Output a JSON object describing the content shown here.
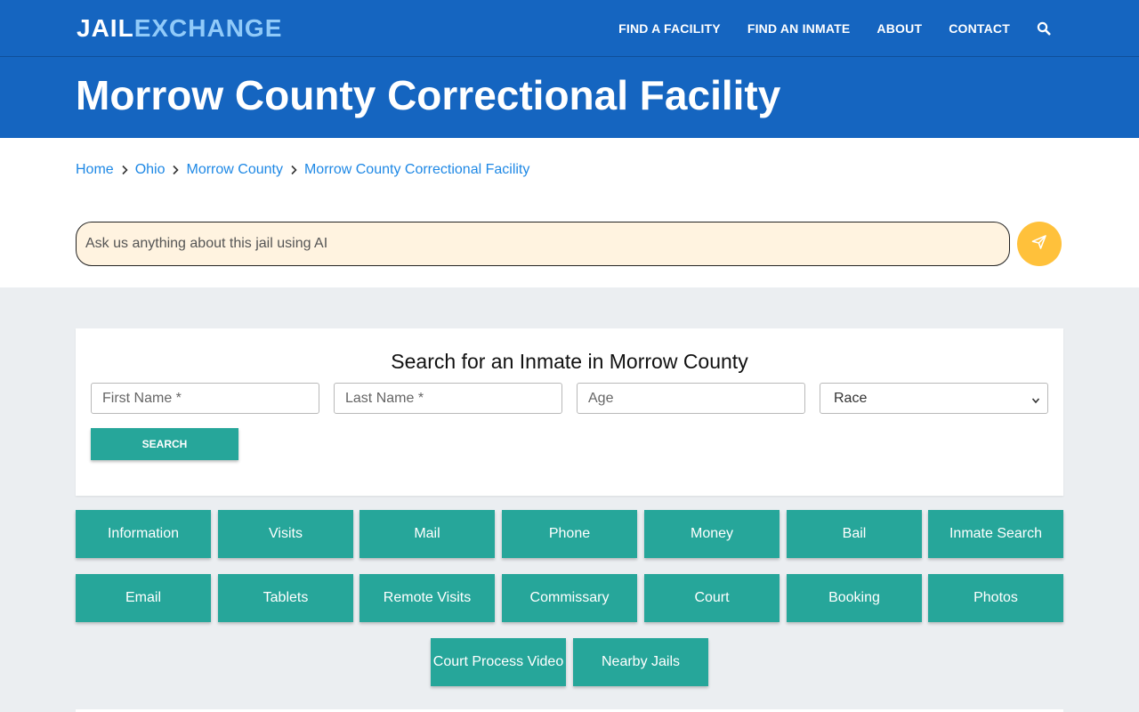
{
  "header": {
    "logo_part1": "JAIL",
    "logo_part2": "EXCHANGE",
    "nav": [
      "FIND A FACILITY",
      "FIND AN INMATE",
      "ABOUT",
      "CONTACT"
    ],
    "search_icon": "search-icon"
  },
  "hero": {
    "title": "Morrow County Correctional Facility"
  },
  "breadcrumb": [
    "Home",
    "Ohio",
    "Morrow County",
    "Morrow County Correctional Facility"
  ],
  "ai": {
    "placeholder": "Ask us anything about this jail using AI",
    "send_icon": "paper-plane-icon"
  },
  "search_card": {
    "title": "Search for an Inmate in Morrow County",
    "first_name_placeholder": "First Name *",
    "last_name_placeholder": "Last Name *",
    "age_placeholder": "Age",
    "race_selected": "Race",
    "button": "SEARCH"
  },
  "tiles": {
    "row1": [
      "Information",
      "Visits",
      "Mail",
      "Phone",
      "Money",
      "Bail",
      "Inmate Search"
    ],
    "row2": [
      "Email",
      "Tablets",
      "Remote Visits",
      "Commissary",
      "Court",
      "Booking",
      "Photos"
    ],
    "row3": [
      "Court Process Video",
      "Nearby Jails"
    ]
  },
  "colors": {
    "primary": "#1565c0",
    "accent": "#26a69a",
    "send": "#ffc13b",
    "logo_accent": "#90caf9"
  }
}
